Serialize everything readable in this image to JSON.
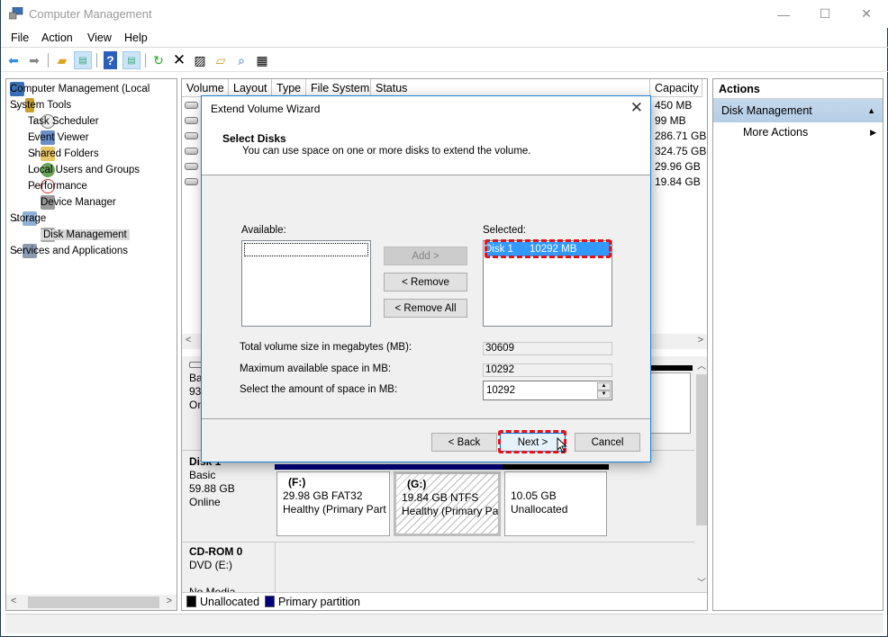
{
  "window": {
    "title": "Computer Management",
    "controls": {
      "minimize": "—",
      "maximize": "☐",
      "close": "✕"
    }
  },
  "menu": [
    "File",
    "Action",
    "View",
    "Help"
  ],
  "toolbar": {
    "buttons": [
      "back-icon",
      "forward-icon",
      "up-folder-icon",
      "show-hide-tree-icon",
      "help-icon",
      "show-hide-action-pane-icon",
      "refresh-icon",
      "delete-icon",
      "properties-icon",
      "open-icon",
      "find-icon",
      "settings-icon"
    ]
  },
  "tree": {
    "items": [
      {
        "label": "Computer Management (Local",
        "level": 0,
        "expander": ""
      },
      {
        "label": "System Tools",
        "level": 1,
        "expander": "⌄"
      },
      {
        "label": "Task Scheduler",
        "level": 2,
        "expander": "›"
      },
      {
        "label": "Event Viewer",
        "level": 2,
        "expander": "›"
      },
      {
        "label": "Shared Folders",
        "level": 2,
        "expander": "›"
      },
      {
        "label": "Local Users and Groups",
        "level": 2,
        "expander": "›"
      },
      {
        "label": "Performance",
        "level": 2,
        "expander": "›"
      },
      {
        "label": "Device Manager",
        "level": 2,
        "expander": ""
      },
      {
        "label": "Storage",
        "level": 1,
        "expander": "⌄"
      },
      {
        "label": "Disk Management",
        "level": 2,
        "expander": "",
        "selected": true
      },
      {
        "label": "Services and Applications",
        "level": 1,
        "expander": "›"
      }
    ]
  },
  "volume_list": {
    "columns": [
      "Volume",
      "Layout",
      "Type",
      "File System",
      "Status",
      "Capacity"
    ],
    "capacities": [
      "450 MB",
      "99 MB",
      "286.71 GB",
      "324.75 GB",
      "29.96 GB",
      "19.84 GB"
    ]
  },
  "disks": [
    {
      "name": "",
      "lines": [
        "Ba",
        "93",
        "On"
      ]
    },
    {
      "name": "Disk 1",
      "type": "Basic",
      "size": "59.88 GB",
      "state": "Online",
      "partitions": [
        {
          "label": "(F:)",
          "size": "29.98 GB FAT32",
          "status": "Healthy (Primary Part",
          "kind": "primary"
        },
        {
          "label": "(G:)",
          "size": "19.84 GB NTFS",
          "status": "Healthy (Primary Par",
          "kind": "primary",
          "selected": true
        },
        {
          "label": "",
          "size": "10.05 GB",
          "status": "Unallocated",
          "kind": "unallocated"
        }
      ]
    },
    {
      "name": "CD-ROM 0",
      "type": "DVD (E:)",
      "state": "No Media"
    }
  ],
  "legend": [
    {
      "label": "Unallocated",
      "color": "#000000"
    },
    {
      "label": "Primary partition",
      "color": "#00007f"
    }
  ],
  "actions": {
    "header": "Actions",
    "section": "Disk Management",
    "items": [
      "More Actions"
    ]
  },
  "dialog": {
    "title": "Extend Volume Wizard",
    "heading": "Select Disks",
    "subheading": "You can use space on one or more disks to extend the volume.",
    "available_label": "Available:",
    "selected_label": "Selected:",
    "available_items": [],
    "selected_items": [
      {
        "disk": "Disk 1",
        "size": "10292 MB"
      }
    ],
    "add_button": "Add >",
    "remove_button": "< Remove",
    "remove_all_button": "< Remove All",
    "total_size_label": "Total volume size in megabytes (MB):",
    "total_size_value": "30609",
    "max_space_label": "Maximum available space in MB:",
    "max_space_value": "10292",
    "select_space_label": "Select the amount of space in MB:",
    "select_space_value": "10292",
    "back_button": "< Back",
    "next_button": "Next >",
    "cancel_button": "Cancel"
  },
  "colors": {
    "primary_partition": "#00007f",
    "unallocated": "#000000",
    "selection": "#3399ff",
    "highlight": "#e0141a",
    "dialog_border": "#1883d7"
  }
}
